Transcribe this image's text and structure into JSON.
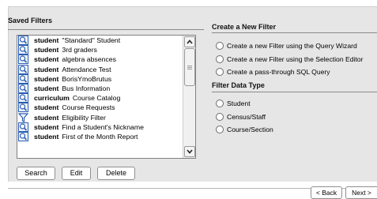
{
  "saved_filters": {
    "title": "Saved Filters",
    "items": [
      {
        "icon": "magnifier-icon",
        "category": "student",
        "name": "\"Standard\" Student"
      },
      {
        "icon": "magnifier-icon",
        "category": "student",
        "name": "3rd graders"
      },
      {
        "icon": "magnifier-icon",
        "category": "student",
        "name": "algebra absences"
      },
      {
        "icon": "magnifier-icon",
        "category": "student",
        "name": "Attendance Test"
      },
      {
        "icon": "magnifier-icon",
        "category": "student",
        "name": "BorisYmoBrutus"
      },
      {
        "icon": "magnifier-icon",
        "category": "student",
        "name": "Bus Information"
      },
      {
        "icon": "magnifier-icon",
        "category": "curriculum",
        "name": "Course Catalog"
      },
      {
        "icon": "magnifier-icon",
        "category": "student",
        "name": "Course Requests"
      },
      {
        "icon": "funnel-icon",
        "category": "student",
        "name": "Eligibility Filter"
      },
      {
        "icon": "magnifier-icon",
        "category": "student",
        "name": "Find a Student's Nickname"
      },
      {
        "icon": "magnifier-icon",
        "category": "student",
        "name": "First of the Month Report"
      }
    ],
    "buttons": {
      "search": "Search",
      "edit": "Edit",
      "delete": "Delete"
    }
  },
  "create_filter": {
    "title": "Create a New Filter",
    "options": [
      "Create a new Filter using the Query Wizard",
      "Create a new Filter using the Selection Editor",
      "Create a pass-through SQL Query"
    ]
  },
  "filter_data_type": {
    "title": "Filter Data Type",
    "options": [
      "Student",
      "Census/Staff",
      "Course/Section"
    ]
  },
  "navigation": {
    "back": "< Back",
    "next": "Next >"
  },
  "colors": {
    "panel": "#e6e6e6",
    "border": "#808080",
    "icon_blue": "#2a5db0"
  }
}
